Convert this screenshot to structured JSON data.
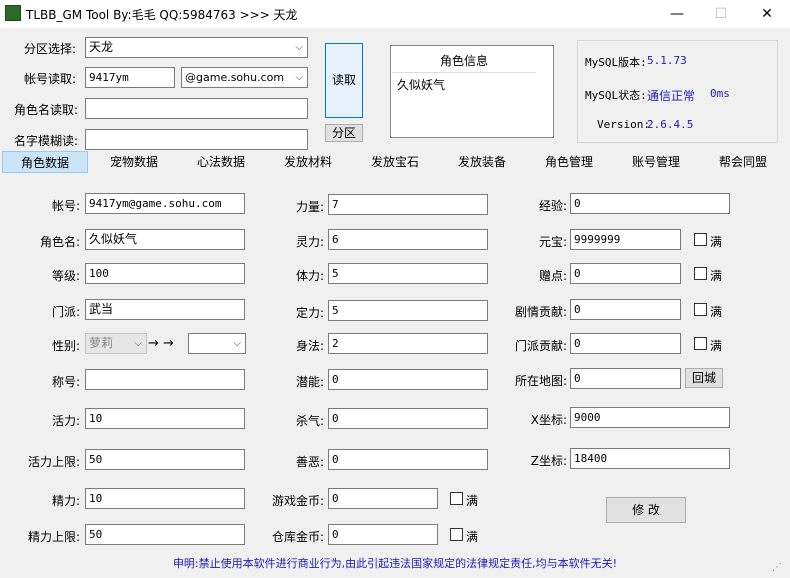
{
  "window": {
    "title": "TLBB_GM Tool By:毛毛 QQ:5984763 >>> 天龙",
    "min": "—",
    "max": "☐",
    "close": "✕"
  },
  "top": {
    "partition_label": "分区选择:",
    "partition_value": "天龙",
    "account_read_label": "帐号读取:",
    "account_value": "9417ym",
    "domain_value": "@game.sohu.com",
    "role_read_label": "角色名读取:",
    "role_read_value": "",
    "fuzzy_label": "名字模糊读:",
    "fuzzy_value": "",
    "read_button": "读取",
    "partition_button": "分区"
  },
  "role_list": {
    "header": "角色信息",
    "items": [
      "久似妖气"
    ]
  },
  "mysql": {
    "version_label": "MySQL版本:",
    "version_value": "5.1.73",
    "status_label": "MySQL状态:",
    "status_value": "通信正常",
    "status_ms": "0ms",
    "tool_version_label": "Version:",
    "tool_version_value": "2.6.4.5"
  },
  "tabs": [
    "角色数据",
    "宠物数据",
    "心法数据",
    "发放材料",
    "发放宝石",
    "发放装备",
    "角色管理",
    "账号管理",
    "帮会同盟"
  ],
  "form": {
    "account_label": "帐号:",
    "account_value": "9417ym@game.sohu.com",
    "role_label": "角色名:",
    "role_value": "久似妖气",
    "level_label": "等级:",
    "level_value": "100",
    "sect_label": "门派:",
    "sect_value": "武当",
    "gender_label": "性别:",
    "gender_value": "萝莉",
    "arrows": "→ →",
    "gender_target": "",
    "title_label": "称号:",
    "title_value": "",
    "vitality_label": "活力:",
    "vitality_value": "10",
    "vitality_max_label": "活力上限:",
    "vitality_max_value": "50",
    "energy_label": "精力:",
    "energy_value": "10",
    "energy_max_label": "精力上限:",
    "energy_max_value": "50",
    "str_label": "力量:",
    "str_value": "7",
    "spirit_label": "灵力:",
    "spirit_value": "6",
    "con_label": "体力:",
    "con_value": "5",
    "focus_label": "定力:",
    "focus_value": "5",
    "dex_label": "身法:",
    "dex_value": "2",
    "potential_label": "潜能:",
    "potential_value": "0",
    "killing_label": "杀气:",
    "killing_value": "0",
    "morality_label": "善恶:",
    "morality_value": "0",
    "game_gold_label": "游戏金币:",
    "game_gold_value": "0",
    "bank_gold_label": "仓库金币:",
    "bank_gold_value": "0",
    "full_label": "满",
    "exp_label": "经验:",
    "exp_value": "0",
    "yuanbao_label": "元宝:",
    "yuanbao_value": "9999999",
    "bonus_label": "赠点:",
    "bonus_value": "0",
    "plot_label": "剧情贡献:",
    "plot_value": "0",
    "sect_contrib_label": "门派贡献:",
    "sect_contrib_value": "0",
    "map_label": "所在地图:",
    "map_value": "0",
    "return_city_button": "回城",
    "x_label": "X坐标:",
    "x_value": "9000",
    "z_label": "Z坐标:",
    "z_value": "18400",
    "modify_button": "修 改"
  },
  "status": "申明:禁止使用本软件进行商业行为,由此引起违法国家规定的法律规定责任,均与本软件无关!"
}
